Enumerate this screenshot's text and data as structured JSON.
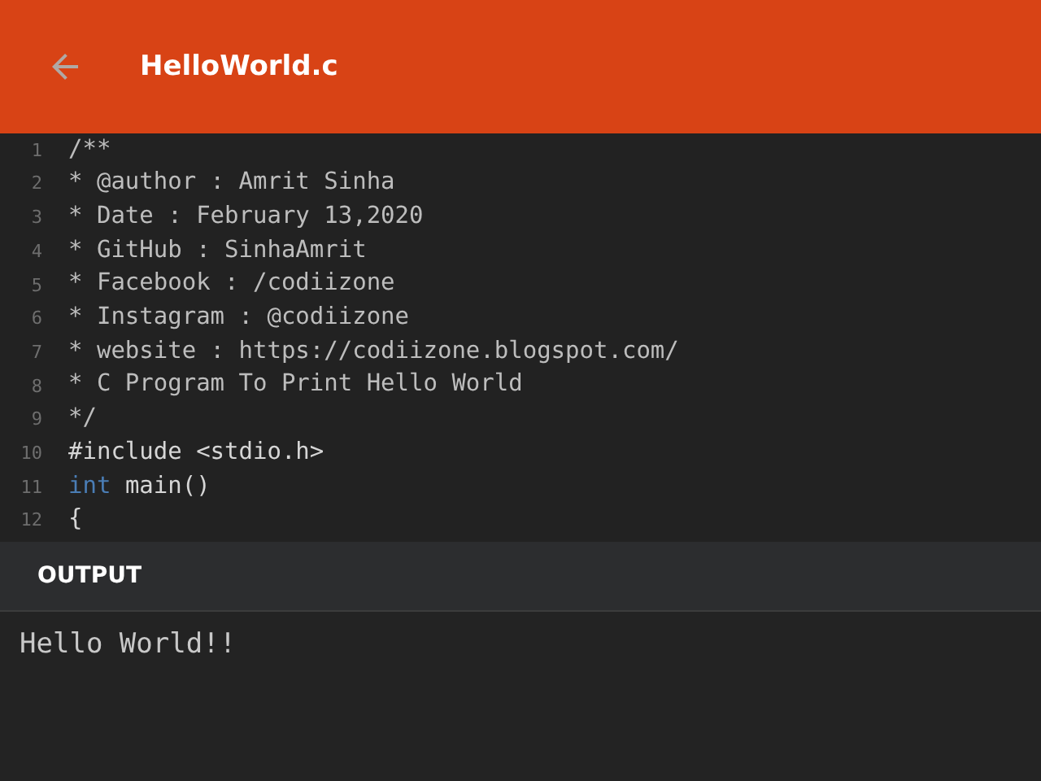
{
  "app_bar": {
    "title": "HelloWorld.c"
  },
  "editor": {
    "lines": [
      {
        "number": "1",
        "tokens": [
          {
            "text": "/**",
            "kind": "comment"
          }
        ]
      },
      {
        "number": "2",
        "tokens": [
          {
            "text": "* @author : Amrit Sinha",
            "kind": "comment"
          }
        ]
      },
      {
        "number": "3",
        "tokens": [
          {
            "text": "* Date : February 13,2020",
            "kind": "comment"
          }
        ]
      },
      {
        "number": "4",
        "tokens": [
          {
            "text": "* GitHub : SinhaAmrit",
            "kind": "comment"
          }
        ]
      },
      {
        "number": "5",
        "tokens": [
          {
            "text": "* Facebook : /codiizone",
            "kind": "comment"
          }
        ]
      },
      {
        "number": "6",
        "tokens": [
          {
            "text": "* Instagram : @codiizone",
            "kind": "comment"
          }
        ]
      },
      {
        "number": "7",
        "tokens": [
          {
            "text": "* website : https://codiizone.blogspot.com/",
            "kind": "comment"
          }
        ]
      },
      {
        "number": "8",
        "tokens": [
          {
            "text": "* C Program To Print Hello World",
            "kind": "comment"
          }
        ]
      },
      {
        "number": "9",
        "tokens": [
          {
            "text": "*/",
            "kind": "comment"
          }
        ]
      },
      {
        "number": "10",
        "tokens": [
          {
            "text": "#include <stdio.h>",
            "kind": "plain"
          }
        ]
      },
      {
        "number": "11",
        "tokens": [
          {
            "text": "int",
            "kind": "keyword"
          },
          {
            "text": "main()",
            "kind": "plain"
          }
        ]
      },
      {
        "number": "12",
        "tokens": [
          {
            "text": "{",
            "kind": "plain"
          }
        ]
      }
    ]
  },
  "output": {
    "heading": "OUTPUT",
    "text": "Hello World!!"
  }
}
